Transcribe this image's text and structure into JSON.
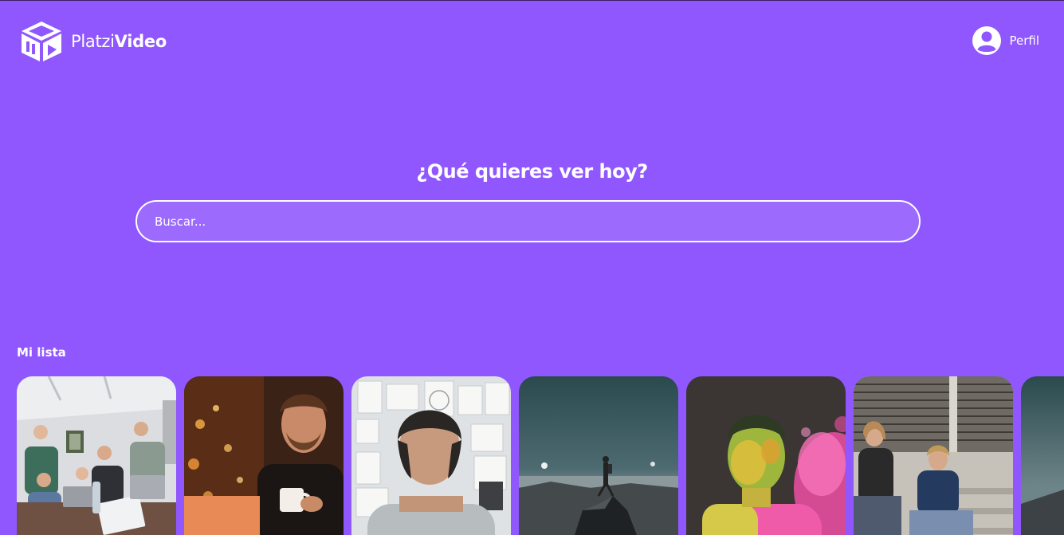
{
  "header": {
    "logo": {
      "light": "Platzi",
      "bold": "Video",
      "icon": "cube-play-icon"
    },
    "profile": {
      "label": "Perfil",
      "icon": "user-avatar-icon"
    }
  },
  "hero": {
    "title": "¿Qué quieres ver hoy?",
    "search_placeholder": "Buscar..."
  },
  "section": {
    "title": "Mi lista"
  },
  "cards": [
    {
      "scene": "team meeting around laptops"
    },
    {
      "scene": "man with coffee mug and laptop, bokeh lights"
    },
    {
      "scene": "man facing wall of sketches"
    },
    {
      "scene": "hiker standing on mountain top"
    },
    {
      "scene": "man covered in colored powder"
    },
    {
      "scene": "two people sitting on steps"
    },
    {
      "scene": "mountain landscape"
    }
  ],
  "colors": {
    "background": "#8f57fd",
    "text": "#ffffff"
  }
}
